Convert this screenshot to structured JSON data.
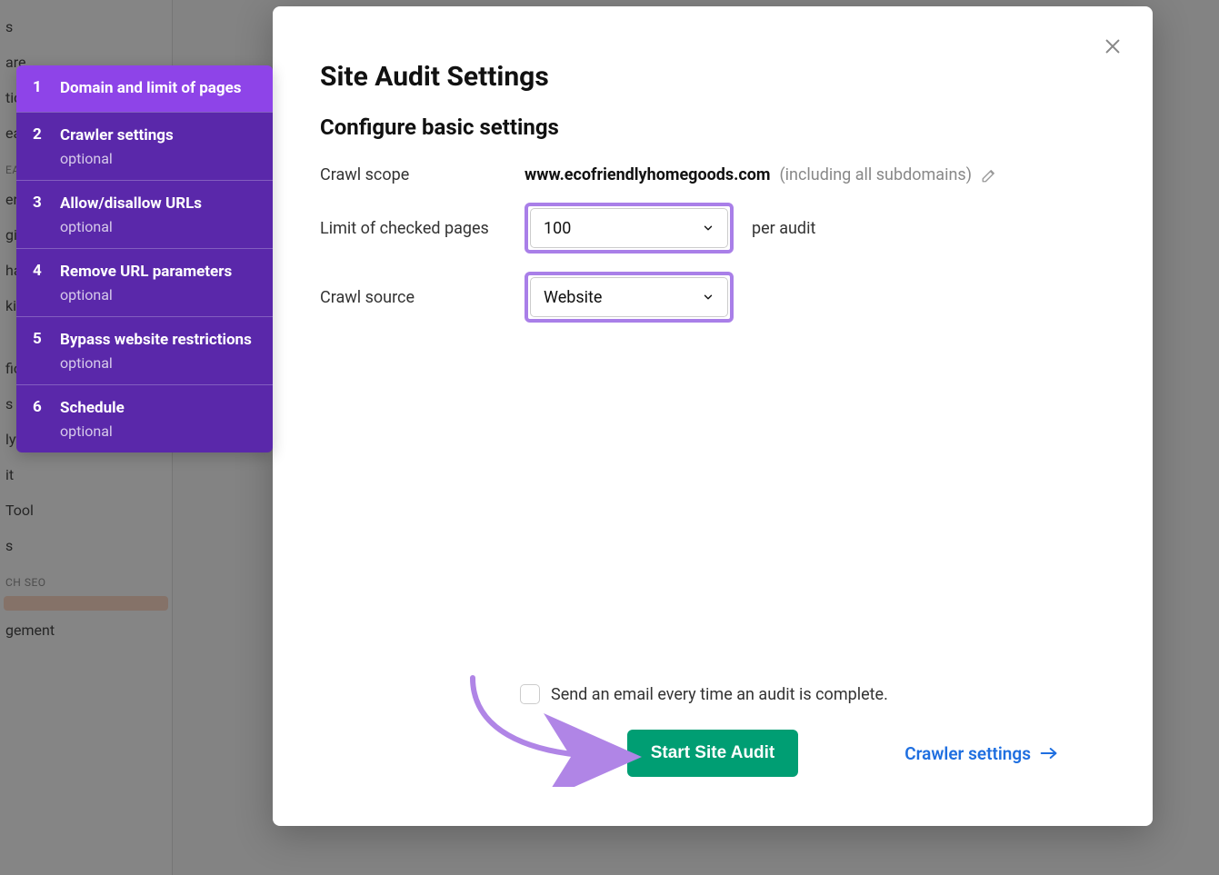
{
  "modal": {
    "title": "Site Audit Settings",
    "subtitle": "Configure basic settings",
    "crawl_scope_label": "Crawl scope",
    "domain": "www.ecofriendlyhomegoods.com",
    "subdomains_note": "(including all subdomains)",
    "limit_label": "Limit of checked pages",
    "limit_value": "100",
    "per_audit": "per audit",
    "crawl_source_label": "Crawl source",
    "crawl_source_value": "Website",
    "email_checkbox": "Send an email every time an audit is complete.",
    "start_btn": "Start Site Audit",
    "next_link": "Crawler settings"
  },
  "steps": [
    {
      "num": "1",
      "title": "Domain and limit of pages",
      "optional": ""
    },
    {
      "num": "2",
      "title": "Crawler settings",
      "optional": "optional"
    },
    {
      "num": "3",
      "title": "Allow/disallow URLs",
      "optional": "optional"
    },
    {
      "num": "4",
      "title": "Remove URL parameters",
      "optional": "optional"
    },
    {
      "num": "5",
      "title": "Bypass website restrictions",
      "optional": "optional"
    },
    {
      "num": "6",
      "title": "Schedule",
      "optional": "optional"
    }
  ],
  "bg_sidebar": {
    "items_top": [
      "s",
      "are",
      "tic",
      "ear"
    ],
    "section1": "EA",
    "items_mid": [
      "erv",
      "gic",
      "ha",
      "ki"
    ],
    "items2": [
      "fic Insights",
      "s",
      "lytics",
      "it",
      " Tool",
      "s"
    ],
    "section2": "CH SEO",
    "highlight_item": " ",
    "items3": [
      "gement"
    ]
  }
}
